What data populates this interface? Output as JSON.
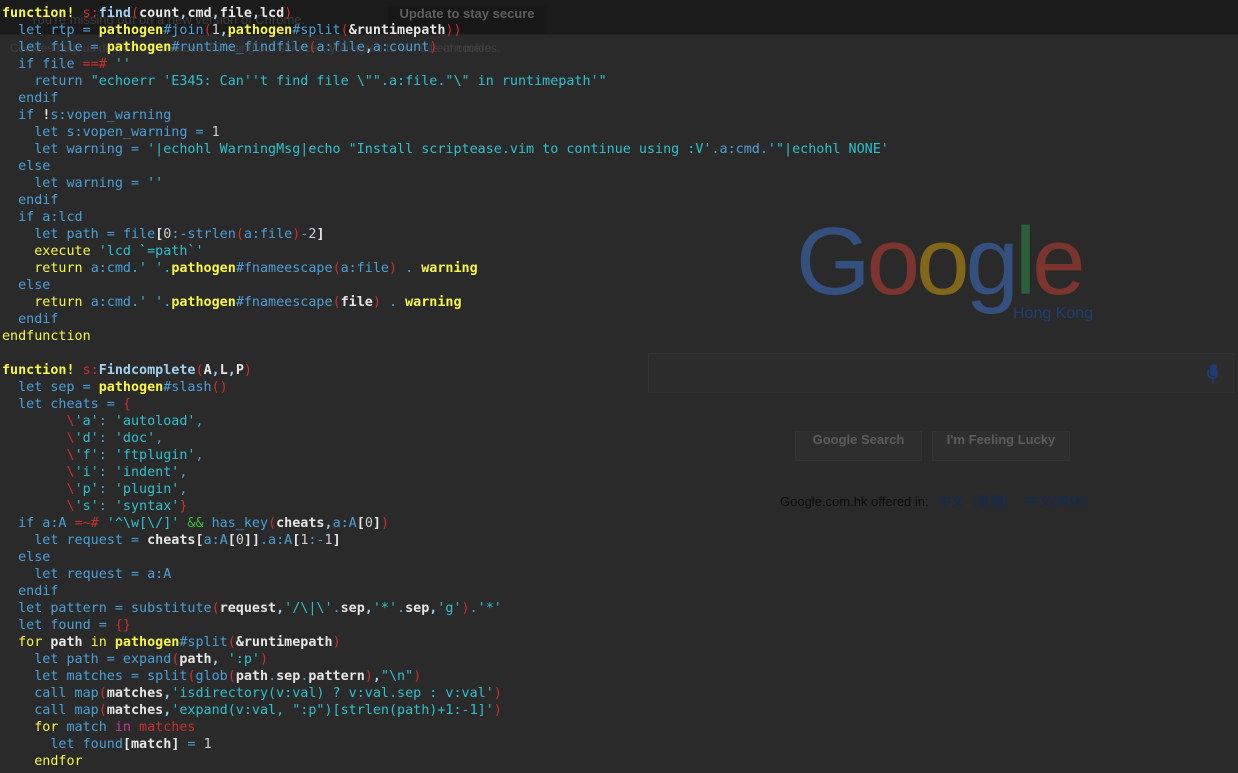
{
  "browser": {
    "chrome_banner": "You're missing out on a new version of Chrome.",
    "update_button": "Update to stay secure",
    "cookie_notice": "Cookies help us deliver our services. By using our services, you agree to our use of cookies.",
    "learn_more": "Learn more",
    "logo_text": "Google",
    "region": "Hong Kong",
    "search_button": "Google Search",
    "lucky_button": "I'm Feeling Lucky",
    "offered_in_label": "Google.com.hk offered in:",
    "languages": [
      "中文（繁體）",
      "中文(简体)"
    ],
    "logo_colors": [
      "#4285f4",
      "#ea4335",
      "#fbbc05",
      "#4285f4",
      "#34a853",
      "#ea4335"
    ]
  },
  "terminal": {
    "colors": {
      "background": "#2a2a2a",
      "keyword": "#f7f74a",
      "identifier": "#4aa0d8",
      "string": "#2dc1ce",
      "operator": "#cc2f2f"
    },
    "lines": [
      [
        [
          "bkw",
          "function!"
        ],
        [
          "id",
          " "
        ],
        [
          "op",
          "s:"
        ],
        [
          "bid",
          "find"
        ],
        [
          "op",
          "("
        ],
        [
          "wht",
          "count"
        ],
        [
          "bid",
          ","
        ],
        [
          "wht",
          "cmd"
        ],
        [
          "bid",
          ","
        ],
        [
          "wht",
          "file"
        ],
        [
          "bid",
          ","
        ],
        [
          "wht",
          "lcd"
        ],
        [
          "op",
          ")"
        ]
      ],
      [
        [
          "id",
          "  let rtp = "
        ],
        [
          "bkw",
          "pathogen"
        ],
        [
          "id",
          "#join"
        ],
        [
          "op",
          "("
        ],
        [
          "num",
          "1"
        ],
        [
          "bid",
          ","
        ],
        [
          "bkw",
          "pathogen"
        ],
        [
          "id",
          "#split"
        ],
        [
          "op",
          "("
        ],
        [
          "wht",
          "&runtimepath"
        ],
        [
          "op",
          "))"
        ]
      ],
      [
        [
          "id",
          "  let "
        ],
        [
          "id",
          "file"
        ],
        [
          "id",
          " = "
        ],
        [
          "bkw",
          "pathogen"
        ],
        [
          "id",
          "#runtime_findfile"
        ],
        [
          "op",
          "("
        ],
        [
          "id",
          "a:file"
        ],
        [
          "bid",
          ","
        ],
        [
          "id",
          "a:count"
        ],
        [
          "op",
          ")"
        ]
      ],
      [
        [
          "id",
          "  if file "
        ],
        [
          "op",
          "==#"
        ],
        [
          "str",
          " ''"
        ]
      ],
      [
        [
          "id",
          "    return "
        ],
        [
          "str",
          "\"echoerr 'E345: Can''t find file \\\"\".a:file.\"\\\" in runtimepath'\""
        ]
      ],
      [
        [
          "id",
          "  endif"
        ]
      ],
      [
        [
          "id",
          "  if "
        ],
        [
          "wht",
          "!"
        ],
        [
          "id",
          "s:vopen_warning"
        ]
      ],
      [
        [
          "id",
          "    let s:vopen_warning = "
        ],
        [
          "num",
          "1"
        ]
      ],
      [
        [
          "id",
          "    let warning = "
        ],
        [
          "str",
          "'|echohl WarningMsg|echo \"Install scriptease.vim to continue using :V'"
        ],
        [
          "id",
          "."
        ],
        [
          "id",
          "a:cmd"
        ],
        [
          "id",
          "."
        ],
        [
          "str",
          "'\"|echohl NONE'"
        ]
      ],
      [
        [
          "id",
          "  else"
        ]
      ],
      [
        [
          "id",
          "    let warning = "
        ],
        [
          "str",
          "''"
        ]
      ],
      [
        [
          "id",
          "  endif"
        ]
      ],
      [
        [
          "id",
          "  if a:lcd"
        ]
      ],
      [
        [
          "id",
          "    let path = "
        ],
        [
          "id",
          "file"
        ],
        [
          "wht",
          "["
        ],
        [
          "num",
          "0"
        ],
        [
          "id",
          ":-strlen"
        ],
        [
          "op",
          "("
        ],
        [
          "id",
          "a:file"
        ],
        [
          "op",
          ")"
        ],
        [
          "id",
          "-"
        ],
        [
          "num",
          "2"
        ],
        [
          "wht",
          "]"
        ]
      ],
      [
        [
          "kw",
          "    execute "
        ],
        [
          "str",
          "'lcd `=path`'"
        ]
      ],
      [
        [
          "kw",
          "    return "
        ],
        [
          "id",
          "a:cmd"
        ],
        [
          "str",
          ".' '."
        ],
        [
          "bkw",
          "pathogen"
        ],
        [
          "id",
          "#fnameescape"
        ],
        [
          "op",
          "("
        ],
        [
          "id",
          "a:file"
        ],
        [
          "op",
          ")"
        ],
        [
          "id",
          " . "
        ],
        [
          "bkw",
          "warning"
        ]
      ],
      [
        [
          "id",
          "  else"
        ]
      ],
      [
        [
          "kw",
          "    return "
        ],
        [
          "id",
          "a:cmd"
        ],
        [
          "str",
          ".' '."
        ],
        [
          "bkw",
          "pathogen"
        ],
        [
          "id",
          "#fnameescape"
        ],
        [
          "op",
          "("
        ],
        [
          "wht",
          "file"
        ],
        [
          "op",
          ")"
        ],
        [
          "id",
          " . "
        ],
        [
          "bkw",
          "warning"
        ]
      ],
      [
        [
          "id",
          "  endif"
        ]
      ],
      [
        [
          "kw",
          "endfunction"
        ]
      ],
      [],
      [
        [
          "bkw",
          "function!"
        ],
        [
          "id",
          " "
        ],
        [
          "op",
          "s:"
        ],
        [
          "bid",
          "Findcomplete"
        ],
        [
          "op",
          "("
        ],
        [
          "wht",
          "A"
        ],
        [
          "bid",
          ","
        ],
        [
          "wht",
          "L"
        ],
        [
          "bid",
          ","
        ],
        [
          "wht",
          "P"
        ],
        [
          "op",
          ")"
        ]
      ],
      [
        [
          "id",
          "  let sep = "
        ],
        [
          "bkw",
          "pathogen"
        ],
        [
          "id",
          "#slash"
        ],
        [
          "op",
          "()"
        ]
      ],
      [
        [
          "id",
          "  let cheats = "
        ],
        [
          "op",
          "{"
        ]
      ],
      [
        [
          "op",
          "        \\"
        ],
        [
          "str",
          "'a'"
        ],
        [
          "id",
          ": "
        ],
        [
          "str",
          "'autoload'"
        ],
        [
          "id",
          ","
        ]
      ],
      [
        [
          "op",
          "        \\"
        ],
        [
          "str",
          "'d'"
        ],
        [
          "id",
          ": "
        ],
        [
          "str",
          "'doc'"
        ],
        [
          "id",
          ","
        ]
      ],
      [
        [
          "op",
          "        \\"
        ],
        [
          "str",
          "'f'"
        ],
        [
          "id",
          ": "
        ],
        [
          "str",
          "'ftplugin'"
        ],
        [
          "id",
          ","
        ]
      ],
      [
        [
          "op",
          "        \\"
        ],
        [
          "str",
          "'i'"
        ],
        [
          "id",
          ": "
        ],
        [
          "str",
          "'indent'"
        ],
        [
          "id",
          ","
        ]
      ],
      [
        [
          "op",
          "        \\"
        ],
        [
          "str",
          "'p'"
        ],
        [
          "id",
          ": "
        ],
        [
          "str",
          "'plugin'"
        ],
        [
          "id",
          ","
        ]
      ],
      [
        [
          "op",
          "        \\"
        ],
        [
          "str",
          "'s'"
        ],
        [
          "id",
          ": "
        ],
        [
          "str",
          "'syntax'"
        ],
        [
          "op",
          "}"
        ]
      ],
      [
        [
          "id",
          "  if a:A "
        ],
        [
          "op",
          "=~#"
        ],
        [
          "str",
          " '^\\w[\\/]'"
        ],
        [
          "grn",
          " &&"
        ],
        [
          "id",
          " has_key"
        ],
        [
          "op",
          "("
        ],
        [
          "wht",
          "cheats"
        ],
        [
          "bid",
          ","
        ],
        [
          "id",
          "a:A"
        ],
        [
          "wht",
          "["
        ],
        [
          "num",
          "0"
        ],
        [
          "wht",
          "]"
        ],
        [
          "op",
          ")"
        ]
      ],
      [
        [
          "id",
          "    let request = "
        ],
        [
          "wht",
          "cheats"
        ],
        [
          "wht",
          "["
        ],
        [
          "id",
          "a:A"
        ],
        [
          "wht",
          "["
        ],
        [
          "num",
          "0"
        ],
        [
          "wht",
          "]]"
        ],
        [
          "id",
          ".a:A"
        ],
        [
          "wht",
          "["
        ],
        [
          "num",
          "1"
        ],
        [
          "id",
          ":-"
        ],
        [
          "num",
          "1"
        ],
        [
          "wht",
          "]"
        ]
      ],
      [
        [
          "id",
          "  else"
        ]
      ],
      [
        [
          "id",
          "    let request = a:A"
        ]
      ],
      [
        [
          "id",
          "  endif"
        ]
      ],
      [
        [
          "id",
          "  let pattern = substitute"
        ],
        [
          "op",
          "("
        ],
        [
          "wht",
          "request"
        ],
        [
          "bid",
          ","
        ],
        [
          "str",
          "'/\\|\\'"
        ],
        [
          "id",
          "."
        ],
        [
          "wht",
          "sep"
        ],
        [
          "bid",
          ","
        ],
        [
          "str",
          "'*'"
        ],
        [
          "id",
          "."
        ],
        [
          "wht",
          "sep"
        ],
        [
          "bid",
          ","
        ],
        [
          "str",
          "'g'"
        ],
        [
          "op",
          ")"
        ],
        [
          "id",
          "."
        ],
        [
          "str",
          "'*'"
        ]
      ],
      [
        [
          "id",
          "  let found = "
        ],
        [
          "op",
          "{}"
        ]
      ],
      [
        [
          "kw",
          "  for "
        ],
        [
          "wht",
          "path"
        ],
        [
          "kw",
          " in "
        ],
        [
          "bkw",
          "pathogen"
        ],
        [
          "id",
          "#split"
        ],
        [
          "op",
          "("
        ],
        [
          "wht",
          "&runtimepath"
        ],
        [
          "op",
          ")"
        ]
      ],
      [
        [
          "id",
          "    let path = expand"
        ],
        [
          "op",
          "("
        ],
        [
          "wht",
          "path"
        ],
        [
          "bid",
          ","
        ],
        [
          "str",
          " ':p'"
        ],
        [
          "op",
          ")"
        ]
      ],
      [
        [
          "id",
          "    let matches = split"
        ],
        [
          "op",
          "("
        ],
        [
          "id",
          "glob"
        ],
        [
          "op",
          "("
        ],
        [
          "wht",
          "path"
        ],
        [
          "id",
          "."
        ],
        [
          "wht",
          "sep"
        ],
        [
          "id",
          "."
        ],
        [
          "wht",
          "pattern"
        ],
        [
          "op",
          ")"
        ],
        [
          "bid",
          ","
        ],
        [
          "str",
          "\"\\n\""
        ],
        [
          "op",
          ")"
        ]
      ],
      [
        [
          "id",
          "    call map"
        ],
        [
          "op",
          "("
        ],
        [
          "wht",
          "matches"
        ],
        [
          "bid",
          ","
        ],
        [
          "str",
          "'isdirectory(v:val) ? v:val.sep : v:val'"
        ],
        [
          "op",
          ")"
        ]
      ],
      [
        [
          "id",
          "    call map"
        ],
        [
          "op",
          "("
        ],
        [
          "wht",
          "matches"
        ],
        [
          "bid",
          ","
        ],
        [
          "str",
          "'expand(v:val, \":p\")[strlen(path)+1:-1]'"
        ],
        [
          "op",
          ")"
        ]
      ],
      [
        [
          "kw",
          "    for "
        ],
        [
          "id",
          "match "
        ],
        [
          "pk",
          "in"
        ],
        [
          "op",
          " matches"
        ]
      ],
      [
        [
          "id",
          "      let found"
        ],
        [
          "wht",
          "["
        ],
        [
          "wht",
          "match"
        ],
        [
          "wht",
          "]"
        ],
        [
          "id",
          " = "
        ],
        [
          "num",
          "1"
        ]
      ],
      [
        [
          "kw",
          "    endfor"
        ]
      ]
    ]
  }
}
